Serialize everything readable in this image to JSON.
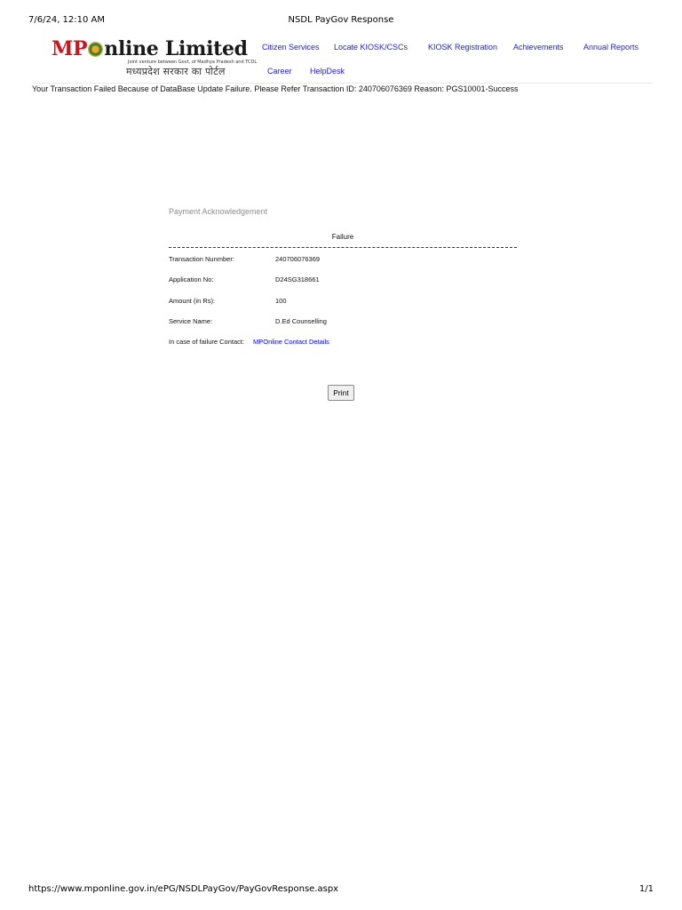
{
  "print_header": {
    "date": "7/6/24, 12:10 AM",
    "title": "NSDL PayGov Response"
  },
  "logo": {
    "mp": "MP",
    "rest": "nline Limited",
    "tagline": "Joint venture between Govt. of Madhya Pradesh and TCDL",
    "hindi": "मध्यप्रदेश सरकार का पोर्टल"
  },
  "nav": {
    "items": [
      "Citizen Services",
      "Locate KIOSK/CSCs",
      "KIOSK Registration",
      "Achievements",
      "Annual Reports",
      "Career",
      "HelpDesk"
    ]
  },
  "status_message": "Your Transaction Failed Because of DataBase Update Failure. Please Refer Transaction ID: 240706076369 Reason: PGS10001-Success",
  "acknowledgement": {
    "title": "Payment Acknowledgement",
    "status": "Failure",
    "rows": [
      {
        "label": "Transaction Nunmber:",
        "value": "240706076369"
      },
      {
        "label": "Application No:",
        "value": "D24SG318661"
      },
      {
        "label": "Amount (in Rs):",
        "value": "100"
      },
      {
        "label": "Service Name:",
        "value": "D.Ed Counselling"
      }
    ],
    "contact_label": "In case of failure Contact:",
    "contact_link": "MPOnline Contact Details"
  },
  "print_button": "Print",
  "print_footer": {
    "url": "https://www.mponline.gov.in/ePG/NSDLPayGov/PayGovResponse.aspx",
    "page": "1/1"
  }
}
